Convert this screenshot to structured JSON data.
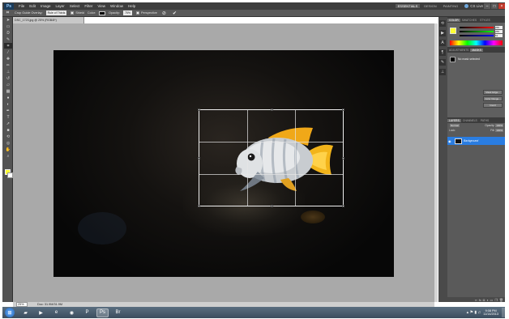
{
  "app": {
    "logo": "Ps",
    "menu": [
      "File",
      "Edit",
      "Image",
      "Layer",
      "Select",
      "Filter",
      "View",
      "Window",
      "Help"
    ],
    "workspaces": [
      "ESSENTIALS",
      "DESIGN",
      "PAINTING"
    ],
    "active_workspace": "ESSENTIALS",
    "cs_live": "CS Live"
  },
  "options_bar": {
    "crop_guide_label": "Crop Guide Overlay:",
    "crop_guide_value": "Rule of Thirds",
    "shield_label": "Shield",
    "color_label": "Color:",
    "shield_color": "#000000",
    "opacity_label": "Opacity:",
    "opacity_value": "75%",
    "perspective_label": "Perspective",
    "cancel_glyph": "⊘",
    "commit_glyph": "✔"
  },
  "document": {
    "tab_title": "DSC_1723.jpg @ 25% (RGB/8*)",
    "zoom": "25%",
    "doc_info": "Doc: 31.9M/31.9M"
  },
  "toolbox": {
    "foreground_color": "#ffff33",
    "background_color": "#ffffff"
  },
  "panels": {
    "color_tabs": [
      "COLOR",
      "SWATCHES",
      "STYLES"
    ],
    "color_values": [
      "255",
      "255",
      "51"
    ],
    "adjust_tabs": [
      "ADJUSTMENTS",
      "MASKS"
    ],
    "mask_title": "No mask selected",
    "mask_buttons": [
      "Mask Edge...",
      "Color Range...",
      "Invert"
    ],
    "layers_tabs": [
      "LAYERS",
      "CHANNELS",
      "PATHS"
    ],
    "blend_mode": "Normal",
    "opacity_label": "Opacity:",
    "opacity_value": "100%",
    "lock_label": "Lock:",
    "fill_label": "Fill:",
    "fill_value": "100%",
    "layer_name": "Background"
  },
  "taskbar": {
    "apps": [
      "start",
      "explorer",
      "media",
      "ie",
      "chrome",
      "ppt",
      "photoshop",
      "bridge"
    ],
    "active_app": "photoshop",
    "time": "9:08 PM",
    "date": "11/14/2013"
  }
}
